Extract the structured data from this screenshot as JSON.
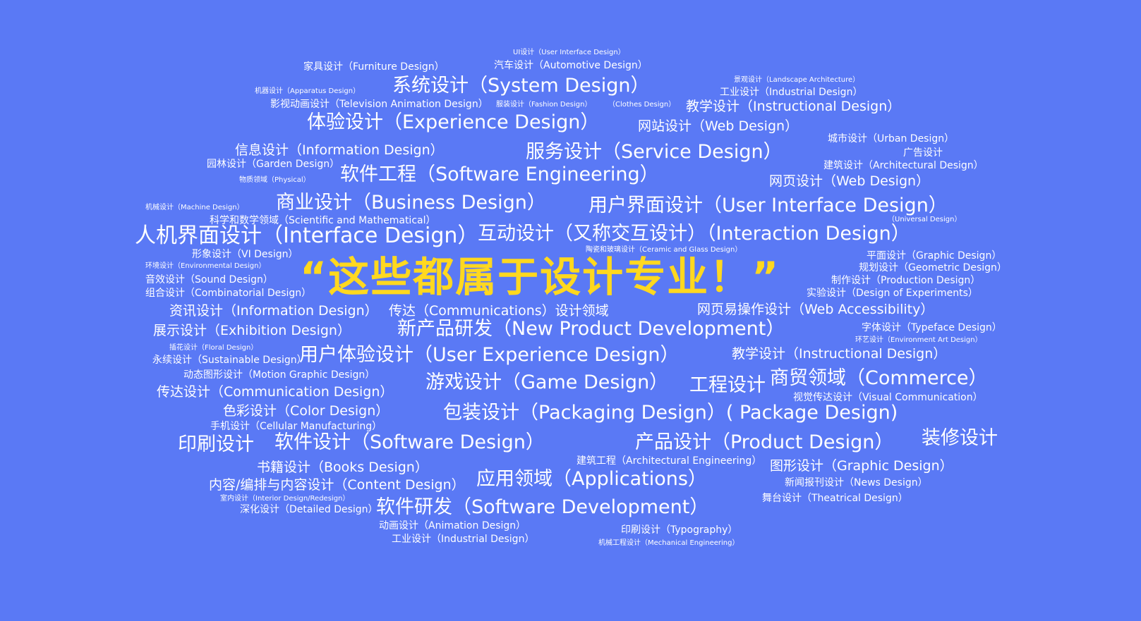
{
  "headline": "“这些都属于设计专业！”",
  "terms": [
    "UI设计（User Interface Design）",
    "家具设计（Furniture Design）",
    "汽车设计（Automotive Design）",
    "景观设计（Landscape Architecture）",
    "机器设计（Apparatus Design）",
    "系统设计（System Design）",
    "工业设计（Industrial Design）",
    "影视动画设计（Television Animation Design）",
    "服装设计（Fashion Design）",
    "（Clothes Design）",
    "教学设计（Instructional Design）",
    "体验设计（Experience Design）",
    "网站设计（Web Design）",
    "城市设计（Urban Design）",
    "信息设计（Information Design）",
    "服务设计（Service Design）",
    "广告设计",
    "园林设计（Garden Design）",
    "建筑设计（Architectural Design）",
    "物质领域（Physical）",
    "软件工程（Software Engineering）",
    "网页设计（Web Design）",
    "机械设计（Machine Design）",
    "商业设计（Business Design）",
    "用户界面设计（User Interface Design）",
    "科学和数学领域（Scientific and Mathematical）",
    "（Universal Design）",
    "人机界面设计（Interface Design）",
    "互动设计（又称交互设计）（Interaction Design）",
    "形象设计（VI Design）",
    "陶瓷和玻璃设计（Ceramic and Glass Design）",
    "环境设计（Environmental Design）",
    "平面设计（Graphic Design）",
    "规划设计（Geometric Design）",
    "音效设计（Sound Design）",
    "制作设计（Production Design）",
    "组合设计（Combinatorial Design）",
    "实验设计（Design of Experiments）",
    "资讯设计（Information Design）",
    "传达（Communications）设计领域",
    "网页易操作设计（Web Accessibility）",
    "展示设计（Exhibition Design）",
    "新产品研发（New Product Development）",
    "字体设计（Typeface Design）",
    "环艺设计（Environment Art Design）",
    "插花设计（Floral Design）",
    "永续设计（Sustainable Design）",
    "用户体验设计（User Experience Design）",
    "教学设计（Instructional Design）",
    "动态图形设计（Motion Graphic Design）",
    "传达设计（Communication Design）",
    "游戏设计（Game Design）",
    "工程设计",
    "商贸领域（Commerce）",
    "视觉传达设计（Visual Communication）",
    "色彩设计（Color Design）",
    "包装设计（Packaging Design）( Package Design)",
    "手机设计（Cellular Manufacturing）",
    "印刷设计",
    "软件设计（Software Design）",
    "产品设计（Product Design）",
    "装修设计",
    "建筑工程（Architectural Engineering）",
    "书籍设计（Books Design）",
    "图形设计（Graphic Design）",
    "内容/编排与内容设计（Content Design）",
    "应用领域（Applications）",
    "新闻报刊设计（News Design）",
    "室内设计（Interior Design/Redesign）",
    "舞台设计（Theatrical Design）",
    "深化设计（Detailed Design）",
    "软件研发（Software Development）",
    "动画设计（Animation Design）",
    "印刷设计（Typography）",
    "工业设计（Industrial Design）",
    "机械工程设计（Mechanical Engineering）"
  ]
}
